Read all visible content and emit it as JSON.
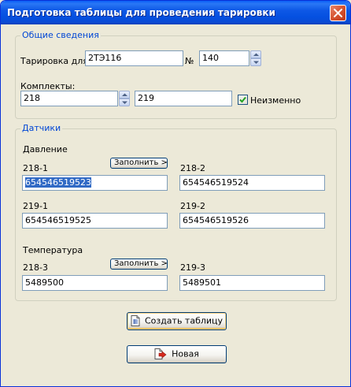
{
  "window": {
    "title": "Подготовка таблицы для проведения тарировки"
  },
  "general": {
    "legend": "Общие сведения",
    "calibration_label": "Тарировка для",
    "calibration_value": "2ТЭ116",
    "number_label": "№",
    "number_value": "140",
    "sets_label": "Комплекты:",
    "set1_value": "218",
    "set2_value": "219",
    "unchanged_label": "Неизменно",
    "unchanged_checked": true
  },
  "sensors": {
    "legend": "Датчики",
    "pressure_label": "Давление",
    "fill_button": "Заполнить >",
    "p1_label": "218-1",
    "p1_value": "654546519523",
    "p2_label": "218-2",
    "p2_value": "654546519524",
    "p3_label": "219-1",
    "p3_value": "654546519525",
    "p4_label": "219-2",
    "p4_value": "654546519526",
    "temperature_label": "Температура",
    "t1_label": "218-3",
    "t1_value": "5489500",
    "t2_label": "219-3",
    "t2_value": "5489501"
  },
  "actions": {
    "create_label": "Создать таблицу",
    "new_label": "Новая"
  },
  "colors": {
    "titlebar": "#0a55e0",
    "legend_text": "#0046d5",
    "selection": "#316ac5",
    "close_button": "#d6532e"
  },
  "icons": {
    "create": "table-icon",
    "new": "new-document-icon",
    "close": "close-icon",
    "check": "check-icon"
  }
}
